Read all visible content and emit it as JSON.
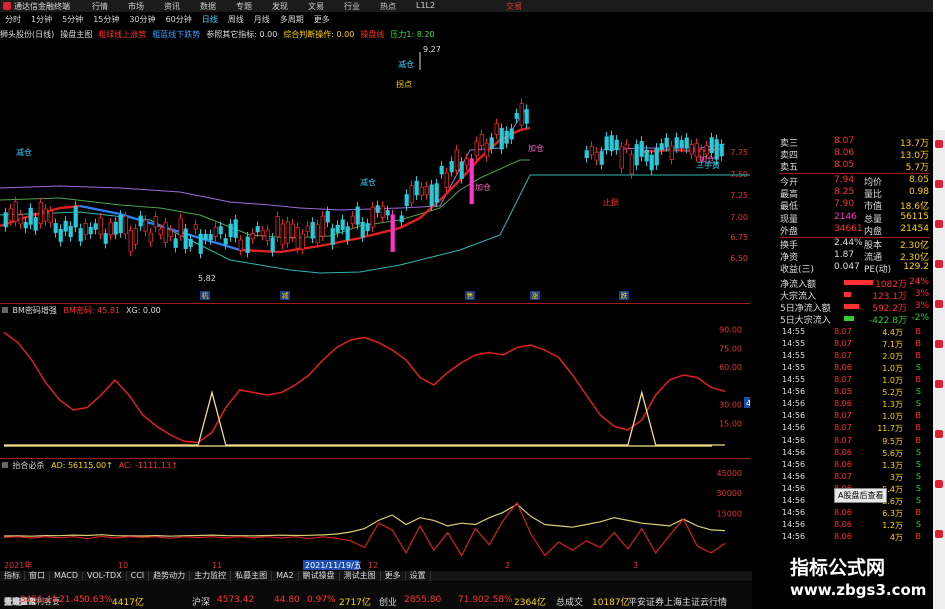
{
  "app": {
    "title": "通达信金融终端",
    "trade_label": "交易"
  },
  "menu": [
    "行情",
    "市场",
    "资讯",
    "数据",
    "专题",
    "发现",
    "文易",
    "行业",
    "热点",
    "L1L2"
  ],
  "periods": [
    {
      "label": "分时",
      "active": false
    },
    {
      "label": "1分钟",
      "active": false
    },
    {
      "label": "5分钟",
      "active": false
    },
    {
      "label": "15分钟",
      "active": false
    },
    {
      "label": "30分钟",
      "active": false
    },
    {
      "label": "60分钟",
      "active": false
    },
    {
      "label": "日线",
      "active": true
    },
    {
      "label": "周线",
      "active": false
    },
    {
      "label": "月线",
      "active": false
    },
    {
      "label": "多周期",
      "active": false
    },
    {
      "label": "更多",
      "active": false
    }
  ],
  "infobar": [
    {
      "text": "狮头股份(日线)",
      "color": "#dddddd"
    },
    {
      "text": "操盘主图",
      "color": "#dddddd"
    },
    {
      "text": "粗绿线上涨势",
      "color": "#ff3030"
    },
    {
      "text": "粗蓝线下跌势",
      "color": "#3aa0ff"
    },
    {
      "text": "参照其它指标: 0.00",
      "color": "#dddddd"
    },
    {
      "text": "综合判断操作: 0.00",
      "color": "#ffd400"
    },
    {
      "text": "操盘线",
      "color": "#ff3030"
    },
    {
      "text": "压力1: 8.20",
      "color": "#40e040"
    }
  ],
  "colors": {
    "red": "#ff3030",
    "green": "#33cc33",
    "cyan": "#33d6ff",
    "yellow": "#ffd400",
    "magenta": "#ff33cc",
    "blue": "#3b82f6"
  },
  "main_chart": {
    "y_ticks": [
      "7.75",
      "7.50",
      "7.25",
      "7.00",
      "6.75",
      "6.50"
    ],
    "labels": [
      {
        "text": "9.27",
        "color": "#dddddd"
      },
      {
        "text": "减仓",
        "color": "#33d6ff"
      },
      {
        "text": "拐点",
        "color": "#ffd400"
      },
      {
        "text": "加仓",
        "color": "#ff66cc"
      },
      {
        "text": "减仓",
        "color": "#33d6ff"
      },
      {
        "text": "减仓",
        "color": "#33d6ff"
      },
      {
        "text": "加仓",
        "color": "#ff66cc"
      },
      {
        "text": "加仓",
        "color": "#ff66cc"
      },
      {
        "text": "三手黄",
        "color": "#33d6ff"
      },
      {
        "text": "止损",
        "color": "#ff3030"
      },
      {
        "text": "5.82",
        "color": "#dddddd"
      }
    ],
    "markers": [
      "机",
      "减",
      "售",
      "涨",
      "跌"
    ]
  },
  "sub1": {
    "name": "BM密码增强",
    "params": [
      {
        "text": "BM密码: 45.81",
        "color": "#ff3030"
      },
      {
        "text": "XG: 0.00",
        "color": "#dddddd"
      }
    ],
    "y_ticks": [
      "90.00",
      "75.00",
      "60.00",
      "30.00",
      "15.00"
    ],
    "last_value": "43.66",
    "chart_data": {
      "type": "line",
      "title": "",
      "series": [
        {
          "name": "BM密码",
          "values": [
            90,
            82,
            68,
            50,
            36,
            28,
            30,
            40,
            52,
            40,
            24,
            15,
            8,
            3,
            2,
            10,
            30,
            44,
            42,
            40,
            42,
            48,
            56,
            68,
            78,
            84,
            86,
            82,
            76,
            68,
            54,
            48,
            58,
            66,
            72,
            74,
            72,
            78,
            80,
            76,
            70,
            56,
            40,
            24,
            15,
            12,
            20,
            40,
            52,
            56,
            54,
            46,
            43
          ]
        },
        {
          "name": "XG",
          "values": [
            0,
            0,
            0,
            0,
            0,
            0,
            0,
            0,
            0,
            0,
            0,
            0,
            0,
            0,
            0,
            42,
            0,
            0,
            0,
            0,
            0,
            0,
            0,
            0,
            0,
            0,
            0,
            0,
            0,
            0,
            0,
            0,
            0,
            0,
            0,
            0,
            0,
            0,
            0,
            0,
            0,
            0,
            0,
            0,
            0,
            0,
            42,
            0,
            0,
            0,
            0,
            0,
            0
          ]
        }
      ],
      "ylim": [
        0,
        100
      ]
    }
  },
  "sub2": {
    "name": "抬合必杀",
    "params": [
      {
        "text": "AD: 56115.00↑",
        "color": "#ffd400"
      },
      {
        "text": "AC: -1111.13↑",
        "color": "#ff3030"
      }
    ],
    "y_ticks": [
      "45000",
      "30000",
      "15000"
    ],
    "chart_data": {
      "type": "line",
      "title": "",
      "series": [
        {
          "name": "AD",
          "values": [
            500,
            600,
            400,
            800,
            700,
            1200,
            900,
            1500,
            700,
            600,
            500,
            800,
            400,
            700,
            900,
            1200,
            800,
            700,
            600,
            900,
            1100,
            900,
            1000,
            1300,
            2000,
            3500,
            6000,
            12000,
            16000,
            9000,
            14000,
            12000,
            8000,
            10000,
            9000,
            14000,
            18000,
            24000,
            15000,
            9000,
            8000,
            7000,
            9000,
            11000,
            14000,
            12000,
            10000,
            9000,
            8000,
            13000,
            8000,
            5000,
            4500
          ]
        },
        {
          "name": "AC",
          "values": [
            -500,
            0,
            -1000,
            0,
            -800,
            0,
            -1500,
            200,
            -900,
            0,
            -500,
            0,
            -1200,
            0,
            -700,
            0,
            -900,
            0,
            -800,
            0,
            -1000,
            0,
            -1500,
            0,
            -1200,
            -3000,
            -8000,
            10000,
            5000,
            -12000,
            8000,
            -10000,
            3000,
            -14000,
            6000,
            -6000,
            12000,
            25000,
            2000,
            -14000,
            -4000,
            -10000,
            -3000,
            -8000,
            3000,
            -9000,
            6000,
            -12000,
            1000,
            13000,
            -7000,
            -12000,
            -5000
          ]
        }
      ],
      "ylim": [
        -15000,
        50000
      ]
    }
  },
  "xaxis": [
    "2021年",
    "10",
    "11",
    "2021/11/19/五",
    "12",
    "2",
    "3"
  ],
  "quote": {
    "asks": [
      {
        "label": "卖三",
        "price": "8.07",
        "vol": "13.7万"
      },
      {
        "label": "卖四",
        "price": "8.06",
        "vol": "13.0万"
      },
      {
        "label": "卖五",
        "price": "8.05",
        "vol": "5.7万"
      }
    ],
    "stats": [
      {
        "label": "今开",
        "v1": "7.94",
        "l2": "均价",
        "v2": "8.05"
      },
      {
        "label": "最高",
        "v1": "8.25",
        "l2": "量比",
        "v2": "0.98"
      },
      {
        "label": "最低",
        "v1": "7.90",
        "l2": "市值",
        "v2": "18.6亿"
      },
      {
        "label": "现量",
        "v1": "2146",
        "l2": "总量",
        "v2": "56115"
      },
      {
        "label": "外盘",
        "v1": "34661",
        "l2": "内盘",
        "v2": "21454"
      },
      {
        "label": "换手",
        "v1": "2.44%",
        "l2": "股本",
        "v2": "2.30亿"
      },
      {
        "label": "净资",
        "v1": "1.87",
        "l2": "流通",
        "v2": "2.30亿"
      },
      {
        "label": "收益(三)",
        "v1": "0.047",
        "l2": "PE(动)",
        "v2": "129.2"
      }
    ],
    "flows": [
      {
        "label": "净流入额",
        "value": "1082万",
        "pct": "24%",
        "color": "#ff3030",
        "fill": 0.85
      },
      {
        "label": "大宗流入",
        "value": "123.1万",
        "pct": "3%",
        "color": "#ff3030",
        "fill": 0.2
      },
      {
        "label": "5日净流入额",
        "value": "592.2万",
        "pct": "3%",
        "color": "#ff3030",
        "fill": 0.45
      },
      {
        "label": "5日大宗流入",
        "value": "-422.8万",
        "pct": "-2%",
        "color": "#33cc33",
        "fill": 0.3
      }
    ],
    "ticks": [
      {
        "time": "14:55",
        "price": "8.07",
        "vol": "4.4万",
        "bs": "B"
      },
      {
        "time": "14:55",
        "price": "8.07",
        "vol": "7.1万",
        "bs": "B"
      },
      {
        "time": "14:55",
        "price": "8.07",
        "vol": "2.0万",
        "bs": "B"
      },
      {
        "time": "14:55",
        "price": "8.06",
        "vol": "1.0万",
        "bs": "S"
      },
      {
        "time": "14:55",
        "price": "8.07",
        "vol": "1.0万",
        "bs": "B"
      },
      {
        "time": "14:56",
        "price": "8.05",
        "vol": "5.2万",
        "bs": "S"
      },
      {
        "time": "14:56",
        "price": "8.06",
        "vol": "1.3万",
        "bs": "S"
      },
      {
        "time": "14:56",
        "price": "8.07",
        "vol": "1.0万",
        "bs": "B"
      },
      {
        "time": "14:56",
        "price": "8.07",
        "vol": "11.7万",
        "bs": "B"
      },
      {
        "time": "14:56",
        "price": "8.07",
        "vol": "9.5万",
        "bs": "B"
      },
      {
        "time": "14:56",
        "price": "8.06",
        "vol": "5.6万",
        "bs": "S"
      },
      {
        "time": "14:56",
        "price": "8.06",
        "vol": "1.3万",
        "bs": "S"
      },
      {
        "time": "14:56",
        "price": "8.07",
        "vol": "3万",
        "bs": "S"
      },
      {
        "time": "14:56",
        "price": "8.06",
        "vol": "5.4万",
        "bs": "S"
      },
      {
        "time": "14:56",
        "price": "8.06",
        "vol": "2.6万",
        "bs": "S"
      },
      {
        "time": "14:56",
        "price": "8.06",
        "vol": "6.3万",
        "bs": "B"
      },
      {
        "time": "14:56",
        "price": "8.06",
        "vol": "1.2万",
        "bs": "S"
      },
      {
        "time": "14:56",
        "price": "8.06",
        "vol": "4万",
        "bs": "B"
      }
    ],
    "popup": "A股盘后查看"
  },
  "bottom_tabs": [
    "指标",
    "窗口",
    "MACD",
    "VOL-TDX",
    "CCI",
    "趋势动力",
    "主力监控",
    "私募主图",
    "MA2",
    "鹏试操盘",
    "测试主图",
    "更多",
    "设置"
  ],
  "bottom_sub": [
    "扩展▲",
    "关联报价",
    "资金分布",
    "综合资讯",
    "行业资讯",
    "互动问答",
    "省略户籍利客要"
  ],
  "indices": [
    {
      "name": "上证",
      "value": "3451.41",
      "chg": "21.45",
      "pct": "0.63%",
      "amount": "4417亿"
    },
    {
      "name": "沪深",
      "value": "4573.42",
      "chg": "44.80",
      "pct": "0.97%",
      "amount": "2717亿"
    },
    {
      "name": "创业",
      "value": "2855.80",
      "chg": "71.90",
      "pct": "2.58%",
      "amount": "2364亿"
    }
  ],
  "status": {
    "label": "总成交",
    "value": "10187亿",
    "server": "平安证券上海主证云行情"
  },
  "watermark": {
    "line1": "指标公式网",
    "line2": "www.zbgs3.com"
  }
}
